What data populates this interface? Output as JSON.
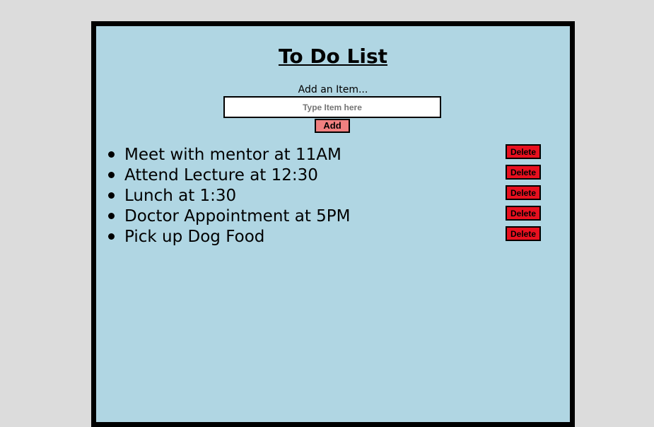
{
  "header": {
    "title": "To Do List"
  },
  "add_form": {
    "label": "Add an Item...",
    "input_value": "",
    "input_placeholder": "Type Item here",
    "add_button_label": "Add"
  },
  "todo_items": [
    {
      "text": "Meet with mentor at 11AM",
      "delete_label": "Delete"
    },
    {
      "text": "Attend Lecture at 12:30",
      "delete_label": "Delete"
    },
    {
      "text": "Lunch at 1:30",
      "delete_label": "Delete"
    },
    {
      "text": "Doctor Appointment at 5PM",
      "delete_label": "Delete"
    },
    {
      "text": "Pick up Dog Food",
      "delete_label": "Delete"
    }
  ],
  "colors": {
    "page_background": "#dcdcdc",
    "panel_background": "#b0d6e3",
    "panel_border": "#000000",
    "add_button": "#f08080",
    "delete_button": "#e8101f"
  }
}
